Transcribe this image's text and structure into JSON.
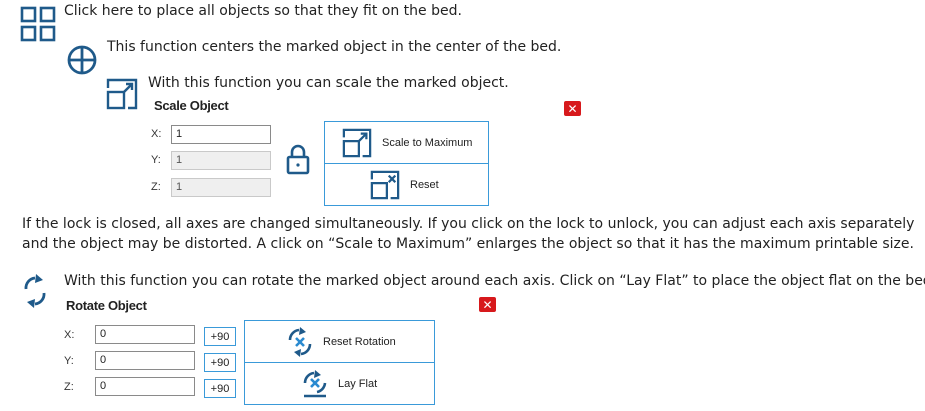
{
  "intro": {
    "arrange_text": "Click here to place all objects so that they fit on the bed.",
    "center_text": "This function centers the marked object in the center of the bed.",
    "scale_text": "With this function you can scale the marked object."
  },
  "scale_panel": {
    "title": "Scale Object",
    "close_label": "✕",
    "x_label": "X:",
    "y_label": "Y:",
    "z_label": "Z:",
    "x_value": "1",
    "y_value": "1",
    "z_value": "1",
    "scale_max_label": "Scale to Maximum",
    "reset_label": "Reset"
  },
  "lock_paragraph": {
    "line1": "If the lock is closed, all axes are changed simultaneously. If you click on the lock to unlock, you can adjust each axis separately",
    "line2": "and the object may be distorted. A click on “Scale to Maximum” enlarges the object so that it has the maximum printable size."
  },
  "rotate_intro": "With this function you can rotate the marked object around each axis. Click on “Lay Flat” to place the object flat on the bed.",
  "rotate_panel": {
    "title": "Rotate Object",
    "close_label": "✕",
    "x_label": "X:",
    "y_label": "Y:",
    "z_label": "Z:",
    "x_value": "0",
    "y_value": "0",
    "z_value": "0",
    "plus_x": "+90",
    "plus_y": "+90",
    "plus_z": "+90",
    "reset_rotation_label": "Reset Rotation",
    "lay_flat_label": "Lay Flat"
  },
  "icons": {
    "arrange": "arrange-grid-icon",
    "center": "center-crosshair-icon",
    "scale": "scale-icon",
    "lock": "lock-icon",
    "rotate": "rotate-icon"
  },
  "colors": {
    "icon_blue": "#1f5a8a",
    "accent_blue": "#3a9ad9",
    "close_red": "#d7191c"
  }
}
